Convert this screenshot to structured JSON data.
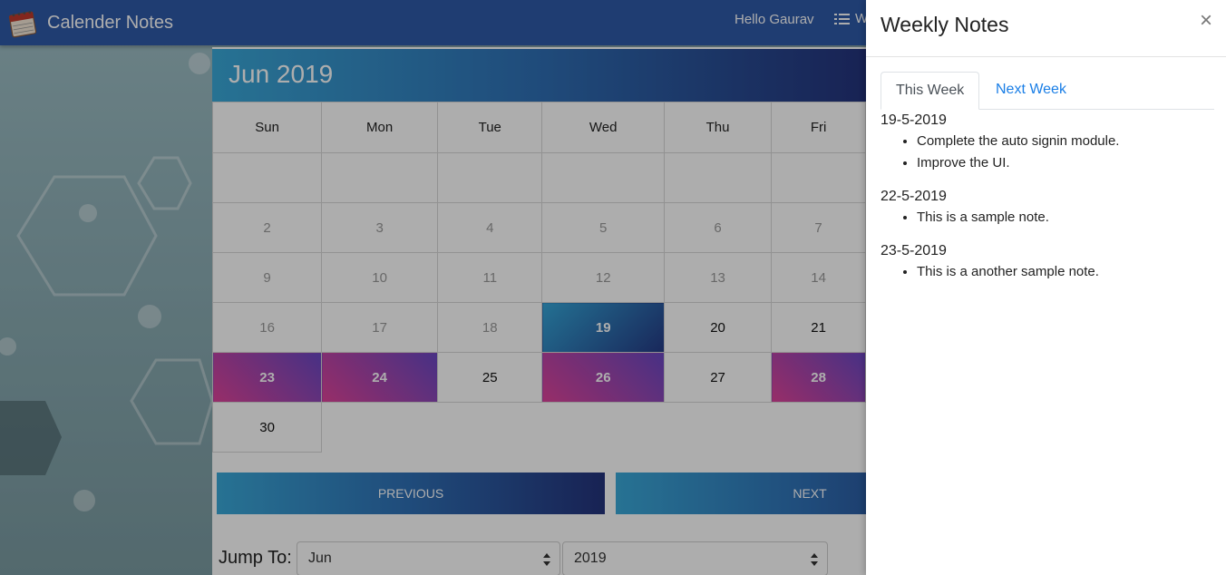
{
  "navbar": {
    "brand": "Calender Notes",
    "greeting": "Hello Gaurav",
    "weekly_label": "W",
    "brand_icon": "calendar-icon",
    "menu_icon": "list-icon"
  },
  "calendar": {
    "title": "Jun 2019",
    "weekdays": [
      "Sun",
      "Mon",
      "Tue",
      "Wed",
      "Thu",
      "Fri"
    ],
    "rows": [
      [
        "",
        "",
        "",
        "",
        "",
        ""
      ],
      [
        "2",
        "3",
        "4",
        "5",
        "6",
        "7"
      ],
      [
        "9",
        "10",
        "11",
        "12",
        "13",
        "14"
      ],
      [
        "16",
        "17",
        "18",
        "19",
        "20",
        "21"
      ],
      [
        "23",
        "24",
        "25",
        "26",
        "27",
        "28"
      ],
      [
        "30",
        "",
        "",
        "",
        "",
        ""
      ]
    ],
    "today": "19",
    "note_days": [
      "23",
      "24",
      "26",
      "28"
    ],
    "previous_label": "PREVIOUS",
    "next_label": "NEXT",
    "jump_label": "Jump To:",
    "month_value": "Jun",
    "year_value": "2019",
    "colors": {
      "accent_start": "#3aa9d9",
      "accent_end": "#24337c",
      "note_start": "#e0439a",
      "note_end": "#6a49c4"
    }
  },
  "panel": {
    "title": "Weekly Notes",
    "close_glyph": "×",
    "tabs": [
      {
        "label": "This Week",
        "active": true
      },
      {
        "label": "Next Week",
        "active": false
      }
    ],
    "notes": [
      {
        "date": "19-5-2019",
        "items": [
          "Complete the auto signin module.",
          "Improve the UI."
        ]
      },
      {
        "date": "22-5-2019",
        "items": [
          "This is a sample note."
        ]
      },
      {
        "date": "23-5-2019",
        "items": [
          "This is a another sample note."
        ]
      }
    ]
  }
}
